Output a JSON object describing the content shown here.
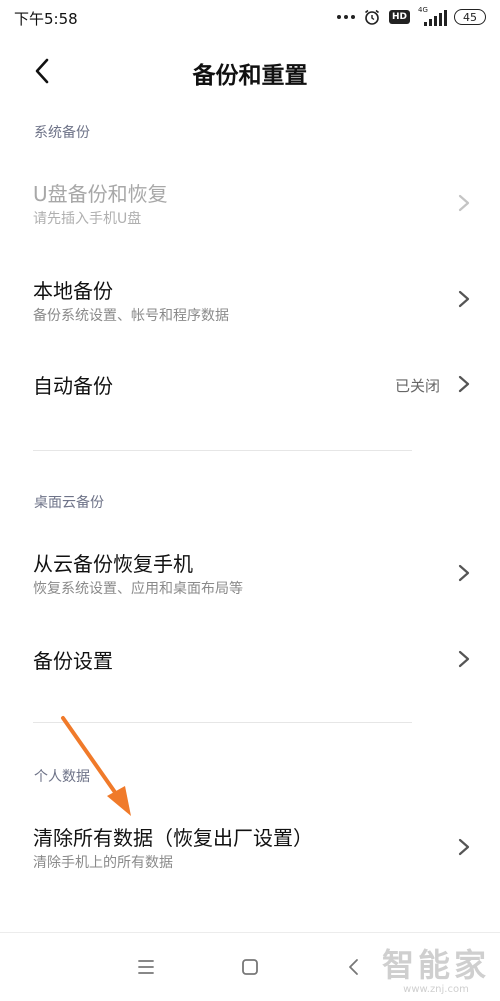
{
  "status_bar": {
    "time": "下午5:58",
    "hd": "HD",
    "network": "4G",
    "battery": "45"
  },
  "header": {
    "title": "备份和重置"
  },
  "sections": {
    "system_backup": {
      "label": "系统备份",
      "usb": {
        "title": "U盘备份和恢复",
        "subtitle": "请先插入手机U盘"
      },
      "local": {
        "title": "本地备份",
        "subtitle": "备份系统设置、帐号和程序数据"
      },
      "auto": {
        "title": "自动备份",
        "value": "已关闭"
      }
    },
    "cloud_backup": {
      "label": "桌面云备份",
      "restore": {
        "title": "从云备份恢复手机",
        "subtitle": "恢复系统设置、应用和桌面布局等"
      },
      "settings": {
        "title": "备份设置"
      }
    },
    "personal_data": {
      "label": "个人数据",
      "erase": {
        "title": "清除所有数据（恢复出厂设置）",
        "subtitle": "清除手机上的所有数据"
      }
    }
  },
  "watermark": {
    "text": "智能家",
    "url": "www.znj.com"
  },
  "colors": {
    "annotation_arrow": "#f07a2a",
    "section_label": "#6e7388"
  }
}
